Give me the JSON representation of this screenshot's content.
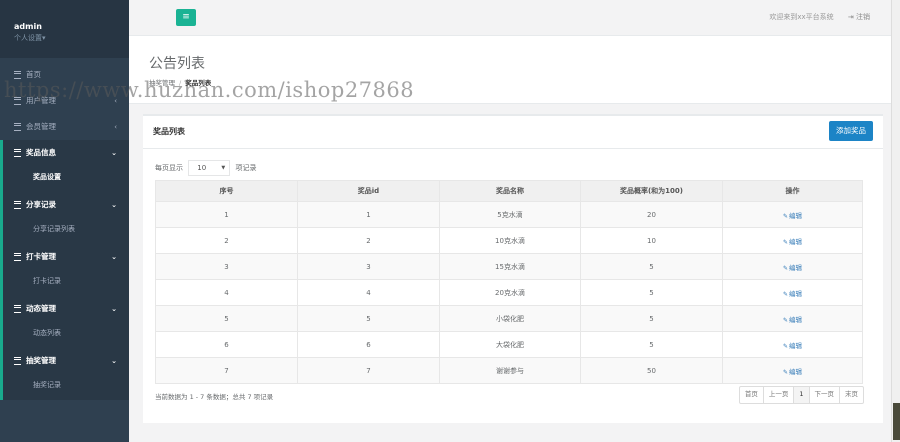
{
  "sidebar": {
    "user": {
      "name": "admin",
      "role": "个人设置▾"
    },
    "items": [
      {
        "label": "首页",
        "chevron": ""
      },
      {
        "label": "用户管理",
        "chevron": "‹"
      },
      {
        "label": "会员管理",
        "chevron": "‹"
      }
    ],
    "groups": [
      {
        "label": "奖品信息",
        "chevron": "⌄",
        "sub": "奖品设置"
      },
      {
        "label": "分享记录",
        "chevron": "⌄",
        "sub": "分享记录列表"
      },
      {
        "label": "打卡管理",
        "chevron": "⌄",
        "sub": "打卡记录"
      },
      {
        "label": "动态管理",
        "chevron": "⌄",
        "sub": "动态列表"
      },
      {
        "label": "抽奖管理",
        "chevron": "⌄",
        "sub": "抽奖记录"
      }
    ]
  },
  "topbar": {
    "menu_icon": "≡",
    "welcome": "欢迎来到xx平台系统",
    "logout_icon": "⇥",
    "logout": "注销"
  },
  "heading": {
    "title": "公告列表",
    "breadcrumb": [
      "抽奖管理",
      "奖品列表"
    ],
    "breadcrumb_sep": "/"
  },
  "watermark": "https://www.huzhan.com/ishop27868",
  "panel": {
    "title": "奖品列表",
    "add_button": "添加奖品",
    "length_prefix": "每页显示",
    "length_value": "10",
    "length_suffix": "项记录",
    "columns": [
      "序号",
      "奖品id",
      "奖品名称",
      "奖品概率(和为100)",
      "操作"
    ],
    "edit_label": "编辑",
    "rows": [
      [
        "1",
        "1",
        "5克水滴",
        "20"
      ],
      [
        "2",
        "2",
        "10克水滴",
        "10"
      ],
      [
        "3",
        "3",
        "15克水滴",
        "5"
      ],
      [
        "4",
        "4",
        "20克水滴",
        "5"
      ],
      [
        "5",
        "5",
        "小袋化肥",
        "5"
      ],
      [
        "6",
        "6",
        "大袋化肥",
        "5"
      ],
      [
        "7",
        "7",
        "谢谢参与",
        "50"
      ]
    ],
    "info": "当前数据为 1 - 7 条数据；总共 7 项记录",
    "pager": [
      "首页",
      "上一页",
      "1",
      "下一页",
      "末页"
    ]
  },
  "colors": {
    "sidebar": "#2f4050",
    "accent": "#1ab394",
    "primary": "#1c84c6"
  }
}
